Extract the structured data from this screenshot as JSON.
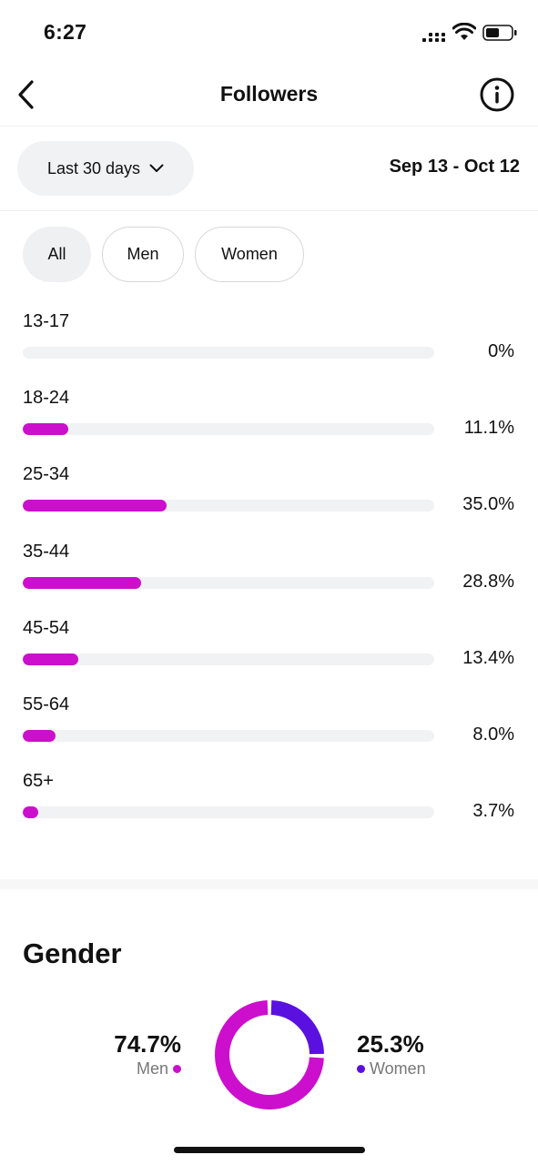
{
  "status_bar": {
    "time": "6:27"
  },
  "header": {
    "title": "Followers"
  },
  "filter": {
    "range_label": "Last 30 days",
    "date_range": "Sep 13 - Oct 12"
  },
  "segments": [
    {
      "label": "All",
      "active": true
    },
    {
      "label": "Men",
      "active": false
    },
    {
      "label": "Women",
      "active": false
    }
  ],
  "age_groups": [
    {
      "label": "13-17",
      "value": 0,
      "pct_text": "0%"
    },
    {
      "label": "18-24",
      "value": 11.1,
      "pct_text": "11.1%"
    },
    {
      "label": "25-34",
      "value": 35.0,
      "pct_text": "35.0%"
    },
    {
      "label": "35-44",
      "value": 28.8,
      "pct_text": "28.8%"
    },
    {
      "label": "45-54",
      "value": 13.4,
      "pct_text": "13.4%"
    },
    {
      "label": "55-64",
      "value": 8.0,
      "pct_text": "8.0%"
    },
    {
      "label": "65+",
      "value": 3.7,
      "pct_text": "3.7%"
    }
  ],
  "gender": {
    "title": "Gender",
    "men": {
      "pct_text": "74.7%",
      "label": "Men",
      "value": 74.7
    },
    "women": {
      "pct_text": "25.3%",
      "label": "Women",
      "value": 25.3
    }
  },
  "colors": {
    "men": "#cc0fcc",
    "women": "#5a11e0",
    "track": "#f1f2f4"
  },
  "icons": {
    "back": "chevron-left-icon",
    "info": "info-icon",
    "dropdown": "chevron-down-icon"
  }
}
